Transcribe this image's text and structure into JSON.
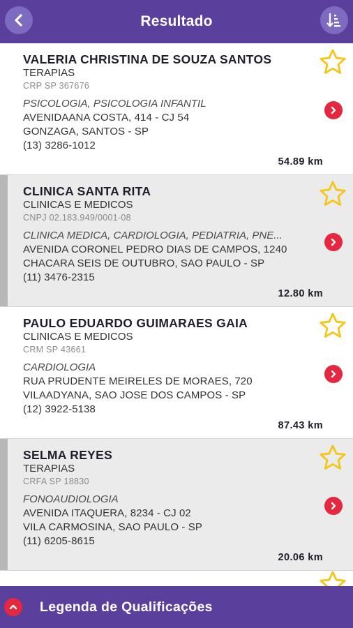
{
  "header": {
    "title": "Resultado",
    "back_icon": "chevron-left-icon",
    "sort_icon": "sort-descending-icon"
  },
  "results": [
    {
      "name": "VALERIA CHRISTINA DE SOUZA SANTOS",
      "category": "TERAPIAS",
      "registration": "CRP SP 367676",
      "specialties": "PSICOLOGIA, PSICOLOGIA INFANTIL",
      "address": "AVENIDAANA COSTA, 414 - CJ 54",
      "city": "GONZAGA, SANTOS - SP",
      "phone": "(13) 3286-1012",
      "distance": "54.89 km"
    },
    {
      "name": "CLINICA SANTA RITA",
      "category": "CLINICAS E MEDICOS",
      "registration": "CNPJ 02.183.949/0001-08",
      "specialties": "CLINICA MEDICA, CARDIOLOGIA, PEDIATRIA, PNE...",
      "address": "AVENIDA CORONEL PEDRO DIAS DE CAMPOS, 1240",
      "city": "CHACARA SEIS DE OUTUBRO, SAO PAULO - SP",
      "phone": "(11) 3476-2315",
      "distance": "12.80 km"
    },
    {
      "name": "PAULO EDUARDO GUIMARAES GAIA",
      "category": "CLINICAS E MEDICOS",
      "registration": "CRM SP 43661",
      "specialties": "CARDIOLOGIA",
      "address": "RUA PRUDENTE MEIRELES DE MORAES, 720",
      "city": "VILAADYANA, SAO JOSE DOS CAMPOS - SP",
      "phone": "(12) 3922-5138",
      "distance": "87.43 km"
    },
    {
      "name": "SELMA REYES",
      "category": "TERAPIAS",
      "registration": "CRFA SP 18830",
      "specialties": "FONOAUDIOLOGIA",
      "address": "AVENIDA ITAQUERA, 8234 - CJ 02",
      "city": "VILA CARMOSINA, SAO PAULO - SP",
      "phone": "(11) 6205-8615",
      "distance": "20.06 km"
    }
  ],
  "icons": {
    "favorite": "star-outline-icon",
    "details": "chevron-right-icon",
    "expand": "chevron-up-icon"
  },
  "colors": {
    "primary": "#5a3f9d",
    "accent": "#e5283f",
    "star": "#f5c518"
  },
  "footer": {
    "label": "Legenda de Qualificações"
  }
}
